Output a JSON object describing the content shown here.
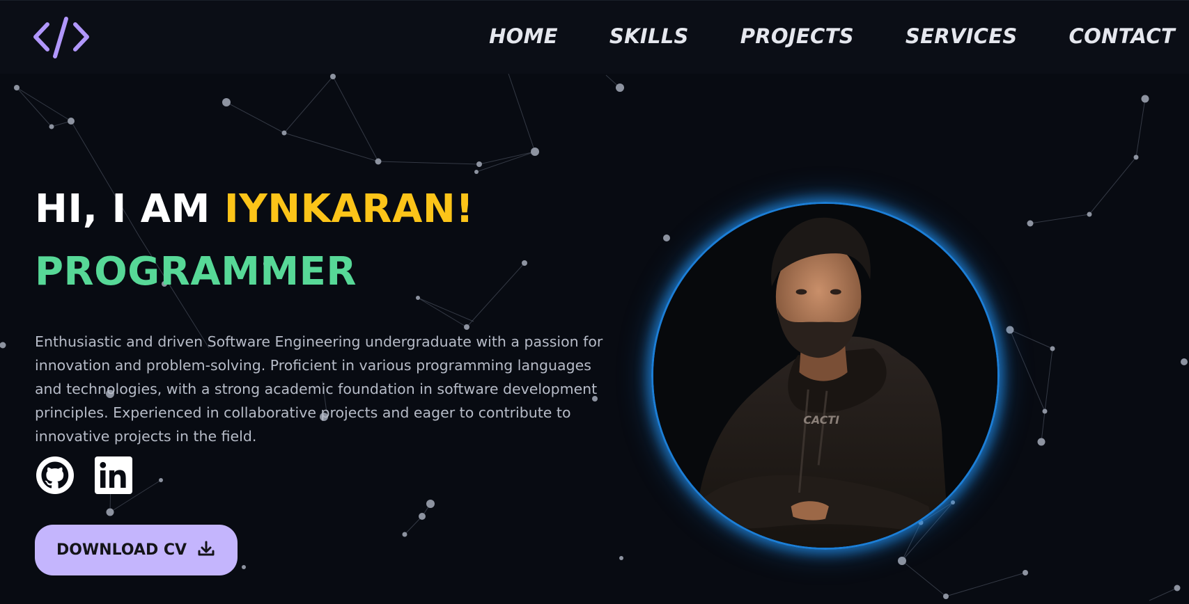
{
  "header": {
    "logo_icon": "code-brackets-icon",
    "nav": [
      {
        "label": "HOME"
      },
      {
        "label": "SKILLS"
      },
      {
        "label": "PROJECTS"
      },
      {
        "label": "SERVICES"
      },
      {
        "label": "CONTACT"
      }
    ]
  },
  "hero": {
    "greeting_prefix": "HI, I AM ",
    "name": "IYNKARAN!",
    "role": "PROGRAMMER",
    "bio": "Enthusiastic and driven Software Engineering undergraduate with a passion for innovation and problem-solving. Proficient in various programming languages and technologies, with a strong academic foundation in software development principles. Experienced in collaborative projects and eager to contribute to innovative projects in the field.",
    "socials": [
      {
        "icon": "github-icon"
      },
      {
        "icon": "linkedin-icon"
      }
    ],
    "download_label": "DOWNLOAD CV",
    "download_icon": "download-icon",
    "portrait_text": "CACTI"
  },
  "colors": {
    "background": "#080b12",
    "accent_name": "#fcc419",
    "accent_role": "#57d897",
    "button": "#c4b5fd",
    "portrait_ring": "#1c7ed6",
    "logo": "#b197fc"
  }
}
